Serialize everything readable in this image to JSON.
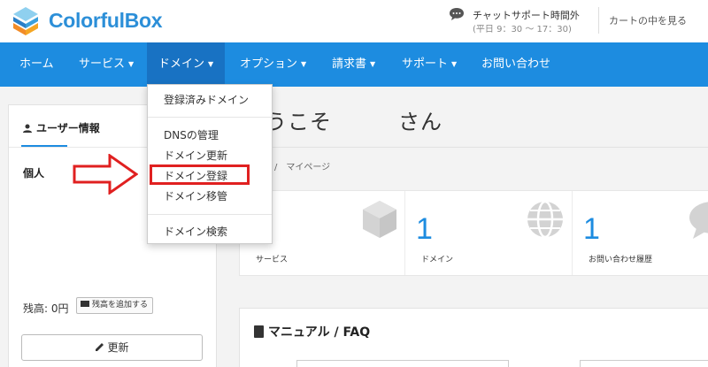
{
  "header": {
    "brand": "ColorfulBox",
    "chat_title": "チャットサポート時間外",
    "chat_hours": "(平日 9：30 〜 17：30)",
    "cart_link": "カートの中を見る",
    "icons": {
      "logo": "colorfulbox-logo",
      "chat": "chat-bubble-icon"
    }
  },
  "nav": {
    "items": [
      {
        "label": "ホーム",
        "caret": false
      },
      {
        "label": "サービス",
        "caret": true
      },
      {
        "label": "ドメイン",
        "caret": true,
        "active": true
      },
      {
        "label": "オプション",
        "caret": true
      },
      {
        "label": "請求書",
        "caret": true
      },
      {
        "label": "サポート",
        "caret": true
      },
      {
        "label": "お問い合わせ",
        "caret": false
      }
    ],
    "caret_glyph": "▼"
  },
  "domain_menu": {
    "items": [
      "登録済みドメイン",
      "DNSの管理",
      "ドメイン更新",
      "ドメイン登録",
      "ドメイン移管",
      "ドメイン検索"
    ],
    "highlighted": "ドメイン登録"
  },
  "user_panel": {
    "title": "ユーザー情報",
    "type": "個人",
    "balance": "残高: 0円",
    "add_balance": "残高を追加する",
    "update": "更新"
  },
  "main": {
    "welcome": "うこそ　　　さん",
    "breadcrumb": "/　マイページ",
    "stats": [
      {
        "value": "",
        "label": "サービス",
        "icon": "box-icon"
      },
      {
        "value": "1",
        "label": "ドメイン",
        "icon": "globe-icon"
      },
      {
        "value": "1",
        "label": "お問い合わせ履歴",
        "icon": "comment-icon"
      }
    ],
    "manual_title": "マニュアル / FAQ"
  },
  "colors": {
    "brand": "#2c8fd8",
    "nav_bg": "#1d8ce0",
    "nav_active": "#1872c3",
    "annotation_red": "#e02020"
  }
}
